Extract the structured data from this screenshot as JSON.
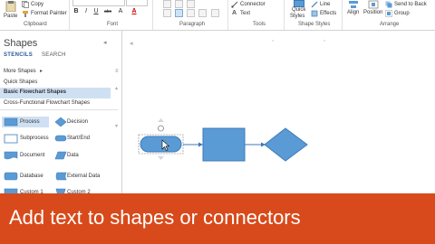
{
  "ribbon": {
    "clipboard": {
      "paste": "Paste",
      "copy": "Copy",
      "format_painter": "Format Painter",
      "label": "Clipboard"
    },
    "font": {
      "bold": "B",
      "italic": "I",
      "underline": "U",
      "strike": "abc",
      "size_inc": "A",
      "font_color": "A",
      "label": "Font"
    },
    "paragraph": {
      "label": "Paragraph"
    },
    "tools": {
      "connector": "Connector",
      "text": "Text",
      "label": "Tools"
    },
    "shape_styles": {
      "quick_styles_1": "Quick",
      "quick_styles_2": "Styles",
      "line": "Line",
      "effects": "Effects",
      "label": "Shape Styles"
    },
    "arrange": {
      "align": "Align",
      "position": "Position",
      "send_to_back": "Send to Back",
      "group": "Group",
      "label": "Arrange"
    }
  },
  "pane": {
    "title": "Shapes",
    "tab_stencils": "STENCILS",
    "tab_search": "SEARCH",
    "more_shapes": "More Shapes",
    "stencils": [
      "Quick Shapes",
      "Basic Flowchart Shapes",
      "Cross-Functional Flowchart Shapes"
    ],
    "masters": [
      {
        "label": "Process"
      },
      {
        "label": "Decision"
      },
      {
        "label": "Subprocess"
      },
      {
        "label": "Start/End"
      },
      {
        "label": "Document"
      },
      {
        "label": "Data"
      },
      {
        "label": "Database"
      },
      {
        "label": "External Data"
      },
      {
        "label": "Custom 1"
      },
      {
        "label": "Custom 2"
      }
    ]
  },
  "banner": {
    "text": "Add text to shapes or connectors"
  },
  "colors": {
    "accent": "#d84a1b",
    "shape_fill": "#5b9bd5",
    "shape_stroke": "#3d7ab8",
    "selection": "#cfe0f3"
  }
}
